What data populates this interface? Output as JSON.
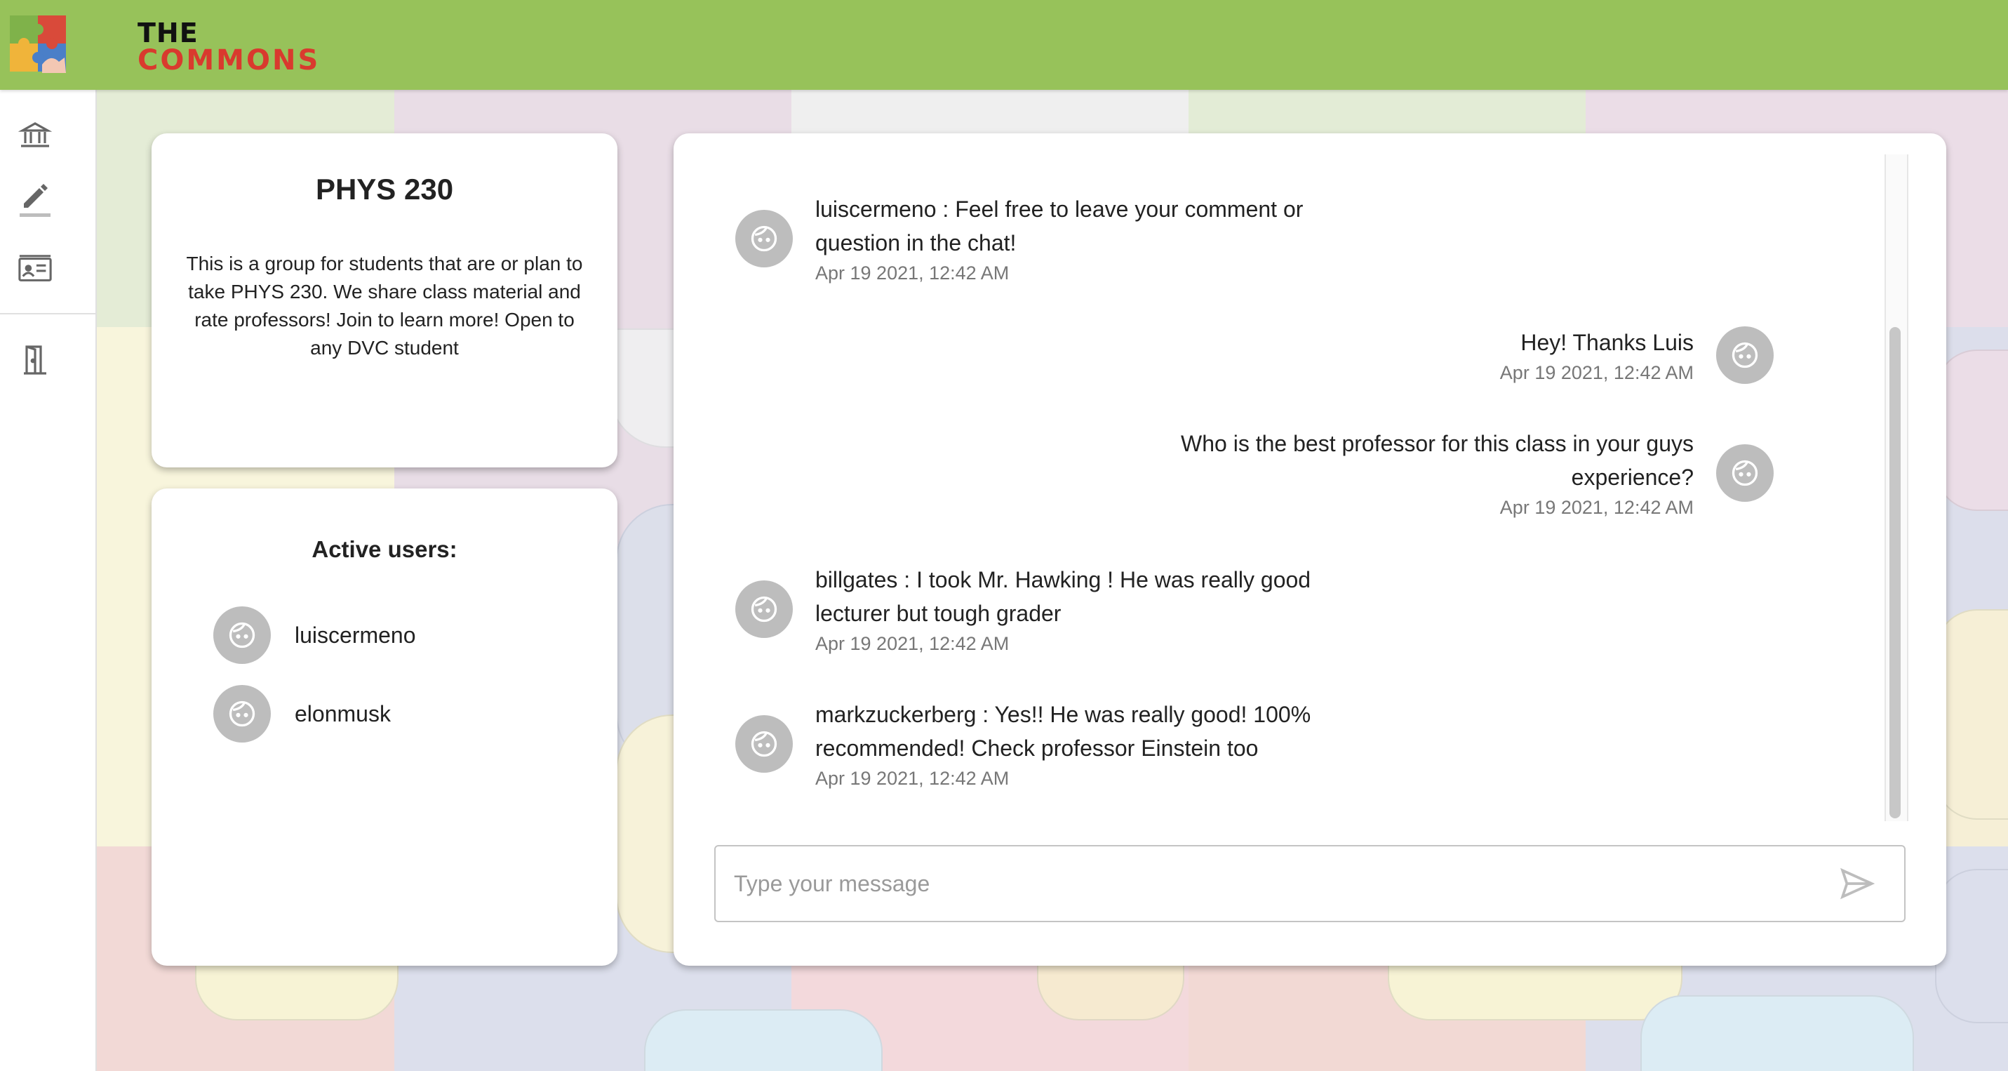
{
  "app": {
    "brand_line1": "THE",
    "brand_line2": "COMMONS",
    "colors": {
      "header": "#97c25a",
      "brand_red": "#d93a2e",
      "avatar": "#bdbdbd"
    }
  },
  "sidebar": {
    "items": [
      {
        "name": "sidebar-item-home",
        "icon": "institution-icon"
      },
      {
        "name": "sidebar-item-edit",
        "icon": "pencil-icon"
      },
      {
        "name": "sidebar-item-profile",
        "icon": "id-card-icon"
      },
      {
        "name": "sidebar-item-logout",
        "icon": "door-icon"
      }
    ]
  },
  "group": {
    "title": "PHYS 230",
    "description": "This is a group for students that are or plan to take PHYS 230. We share class material and rate professors! Join to learn more! Open to any DVC student"
  },
  "active_users": {
    "title": "Active users:",
    "users": [
      {
        "username": "luiscermeno",
        "icon": "face-icon"
      },
      {
        "username": "elonmusk",
        "icon": "face-icon"
      }
    ]
  },
  "chat": {
    "messages": [
      {
        "side": "left",
        "text": "luiscermeno : Feel free to leave your comment or question in the chat!",
        "time": "Apr 19 2021, 12:42 AM"
      },
      {
        "side": "right",
        "text": "Hey! Thanks Luis",
        "time": "Apr 19 2021, 12:42 AM"
      },
      {
        "side": "right",
        "text": "Who is the best professor for this class in your guys experience?",
        "time": "Apr 19 2021, 12:42 AM"
      },
      {
        "side": "left",
        "text": "billgates : I took Mr. Hawking ! He was really good lecturer but tough grader",
        "time": "Apr 19 2021, 12:42 AM"
      },
      {
        "side": "left",
        "text": "markzuckerberg : Yes!! He was really good! 100% recommended! Check professor Einstein too",
        "time": "Apr 19 2021, 12:42 AM"
      }
    ],
    "input": {
      "value": "",
      "placeholder": "Type your message"
    },
    "send_icon": "send-icon"
  }
}
